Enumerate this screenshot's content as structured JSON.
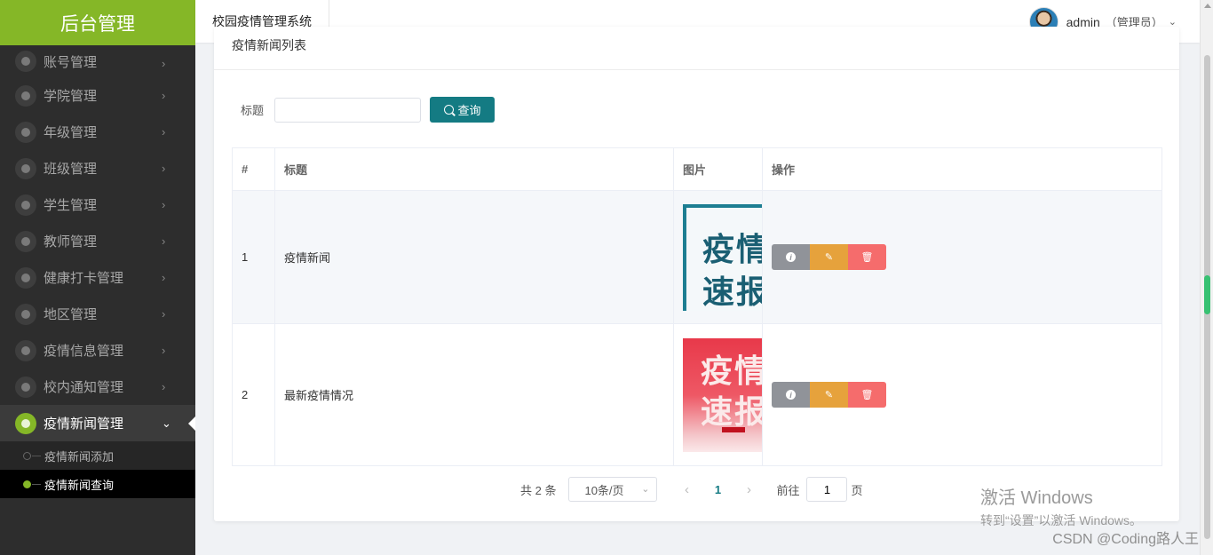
{
  "brand": "后台管理",
  "header": {
    "system_title": "校园疫情管理系统",
    "username": "admin",
    "role": "（管理员）"
  },
  "sidebar": {
    "items": [
      {
        "label": "账号管理"
      },
      {
        "label": "学院管理"
      },
      {
        "label": "年级管理"
      },
      {
        "label": "班级管理"
      },
      {
        "label": "学生管理"
      },
      {
        "label": "教师管理"
      },
      {
        "label": "健康打卡管理"
      },
      {
        "label": "地区管理"
      },
      {
        "label": "疫情信息管理"
      },
      {
        "label": "校内通知管理"
      },
      {
        "label": "疫情新闻管理",
        "active": true
      }
    ],
    "sub_items": [
      {
        "label": "疫情新闻添加"
      },
      {
        "label": "疫情新闻查询",
        "active": true
      }
    ]
  },
  "card": {
    "title": "疫情新闻列表"
  },
  "search": {
    "label": "标题",
    "value": "",
    "button": "查询"
  },
  "table": {
    "headers": [
      "#",
      "标题",
      "图片",
      "操作"
    ],
    "rows": [
      {
        "index": "1",
        "title": "疫情新闻",
        "image_text": [
          "疫情",
          "速报"
        ],
        "image_style": "blue"
      },
      {
        "index": "2",
        "title": "最新疫情情况",
        "image_text": [
          "疫情",
          "速报"
        ],
        "image_style": "red"
      }
    ]
  },
  "pagination": {
    "total": "共 2 条",
    "page_size": "10条/页",
    "current_page": "1",
    "goto_label": "前往",
    "goto_value": "1",
    "page_unit": "页"
  },
  "watermark": {
    "activate_title": "激活 Windows",
    "activate_sub": "转到“设置”以激活 Windows。",
    "csdn": "CSDN @Coding路人王"
  },
  "colors": {
    "brand_green": "#85b727",
    "sidebar_bg": "#2d2d2d",
    "primary_teal": "#147b83",
    "info_gray": "#909399",
    "warning_orange": "#e6a23c",
    "danger_red": "#f56c6c"
  }
}
